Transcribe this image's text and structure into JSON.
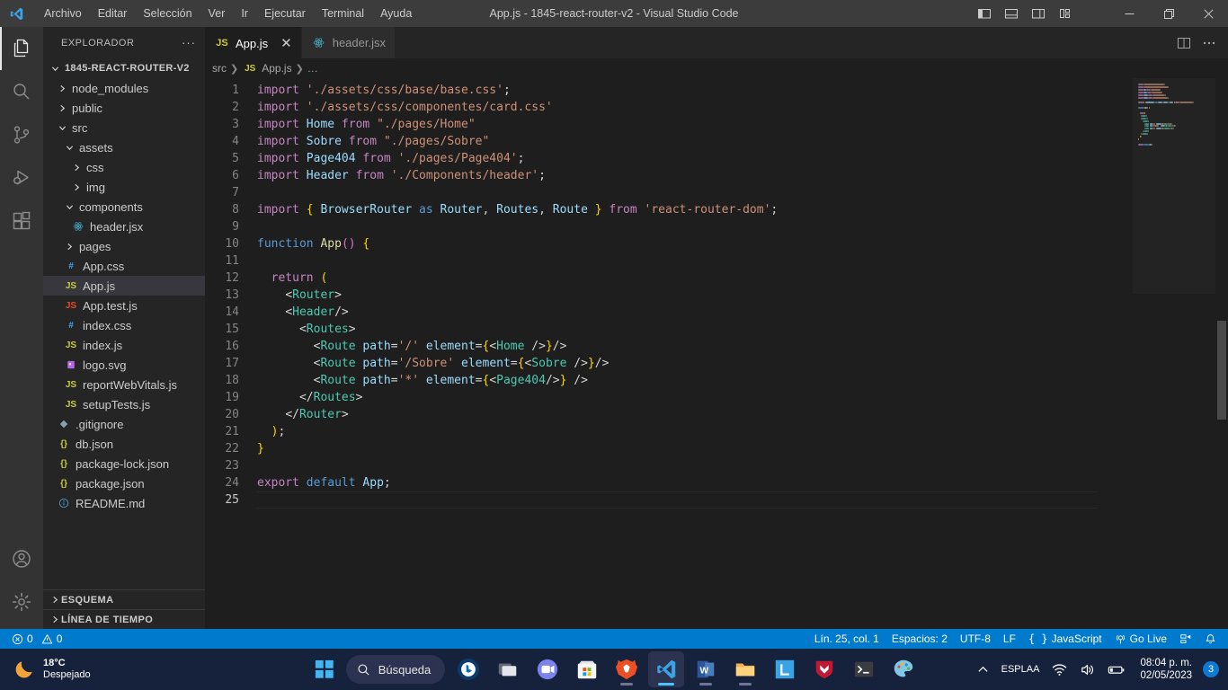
{
  "window": {
    "title": "App.js - 1845-react-router-v2 - Visual Studio Code",
    "menu": [
      "Archivo",
      "Editar",
      "Selección",
      "Ver",
      "Ir",
      "Ejecutar",
      "Terminal",
      "Ayuda"
    ],
    "layout_buttons": [
      "toggle-primary-sidebar",
      "toggle-panel",
      "toggle-secondary-sidebar",
      "customize-layout"
    ],
    "controls": {
      "minimize": "—",
      "maximize": "▢",
      "close": "✕"
    }
  },
  "activitybar": {
    "items": [
      {
        "name": "explorer",
        "icon": "files-icon",
        "active": true
      },
      {
        "name": "search",
        "icon": "search-icon",
        "active": false
      },
      {
        "name": "source-control",
        "icon": "source-control-icon",
        "active": false
      },
      {
        "name": "run-and-debug",
        "icon": "run-debug-icon",
        "active": false
      },
      {
        "name": "extensions",
        "icon": "extensions-icon",
        "active": false
      }
    ],
    "bottom": [
      {
        "name": "accounts",
        "icon": "account-icon"
      },
      {
        "name": "manage",
        "icon": "gear-icon"
      }
    ]
  },
  "sidebar": {
    "title": "EXPLORADOR",
    "more_actions": "···",
    "root": {
      "label": "1845-REACT-ROUTER-V2",
      "expanded": true
    },
    "tree": [
      {
        "label": "node_modules",
        "type": "folder",
        "depth": 1,
        "expanded": false,
        "icon": "chevron-right-icon"
      },
      {
        "label": "public",
        "type": "folder",
        "depth": 1,
        "expanded": false,
        "icon": "chevron-right-icon"
      },
      {
        "label": "src",
        "type": "folder",
        "depth": 1,
        "expanded": true,
        "icon": "chevron-down-icon"
      },
      {
        "label": "assets",
        "type": "folder",
        "depth": 2,
        "expanded": true,
        "icon": "chevron-down-icon"
      },
      {
        "label": "css",
        "type": "folder",
        "depth": 3,
        "expanded": false,
        "icon": "chevron-right-icon"
      },
      {
        "label": "img",
        "type": "folder",
        "depth": 3,
        "expanded": false,
        "icon": "chevron-right-icon"
      },
      {
        "label": "components",
        "type": "folder",
        "depth": 2,
        "expanded": true,
        "icon": "chevron-down-icon"
      },
      {
        "label": "header.jsx",
        "type": "file",
        "depth": 3,
        "icon": "react-icon",
        "color": "#4db6d6"
      },
      {
        "label": "pages",
        "type": "folder",
        "depth": 2,
        "expanded": false,
        "icon": "chevron-right-icon"
      },
      {
        "label": "App.css",
        "type": "file",
        "depth": 2,
        "icon": "css-icon",
        "color": "#42a5f5",
        "glyph": "#"
      },
      {
        "label": "App.js",
        "type": "file",
        "depth": 2,
        "icon": "js-icon",
        "color": "#cbcb41",
        "glyph": "JS",
        "selected": true
      },
      {
        "label": "App.test.js",
        "type": "file",
        "depth": 2,
        "icon": "js-test-icon",
        "color": "#e44d26",
        "glyph": "JS"
      },
      {
        "label": "index.css",
        "type": "file",
        "depth": 2,
        "icon": "css-icon",
        "color": "#42a5f5",
        "glyph": "#"
      },
      {
        "label": "index.js",
        "type": "file",
        "depth": 2,
        "icon": "js-icon",
        "color": "#cbcb41",
        "glyph": "JS"
      },
      {
        "label": "logo.svg",
        "type": "file",
        "depth": 2,
        "icon": "svg-icon",
        "color": "#b36ae2"
      },
      {
        "label": "reportWebVitals.js",
        "type": "file",
        "depth": 2,
        "icon": "js-icon",
        "color": "#cbcb41",
        "glyph": "JS"
      },
      {
        "label": "setupTests.js",
        "type": "file",
        "depth": 2,
        "icon": "js-icon",
        "color": "#cbcb41",
        "glyph": "JS"
      },
      {
        "label": ".gitignore",
        "type": "file",
        "depth": 1,
        "icon": "git-icon",
        "color": "#8ba3ae"
      },
      {
        "label": "db.json",
        "type": "file",
        "depth": 1,
        "icon": "json-icon",
        "color": "#cbcb41",
        "glyph": "{}"
      },
      {
        "label": "package-lock.json",
        "type": "file",
        "depth": 1,
        "icon": "json-icon",
        "color": "#cbcb41",
        "glyph": "{}"
      },
      {
        "label": "package.json",
        "type": "file",
        "depth": 1,
        "icon": "json-icon",
        "color": "#cbcb41",
        "glyph": "{}"
      },
      {
        "label": "README.md",
        "type": "file",
        "depth": 1,
        "icon": "info-icon",
        "color": "#4a9fd5"
      }
    ],
    "panels": [
      {
        "label": "ESQUEMA",
        "expanded": false
      },
      {
        "label": "LÍNEA DE TIEMPO",
        "expanded": false
      }
    ]
  },
  "editor": {
    "tabs": [
      {
        "label": "App.js",
        "icon": "js-icon",
        "glyph": "JS",
        "active": true,
        "close": "✕"
      },
      {
        "label": "header.jsx",
        "icon": "react-icon",
        "active": false
      }
    ],
    "actions": [
      "split-editor-right",
      "more-actions"
    ],
    "breadcrumbs": [
      {
        "label": "src",
        "icon": ""
      },
      {
        "label": "App.js",
        "icon": "js-icon",
        "glyph": "JS"
      },
      {
        "label": "…",
        "icon": ""
      }
    ],
    "total_lines": 25,
    "lines": [
      {
        "n": 1,
        "tokens": [
          {
            "t": "import ",
            "c": "t-kw"
          },
          {
            "t": "'./assets/css/base/base.css'",
            "c": "t-str"
          },
          {
            "t": ";",
            "c": "t-plain"
          }
        ]
      },
      {
        "n": 2,
        "tokens": [
          {
            "t": "import ",
            "c": "t-kw"
          },
          {
            "t": "'./assets/css/componentes/card.css'",
            "c": "t-str"
          }
        ]
      },
      {
        "n": 3,
        "tokens": [
          {
            "t": "import ",
            "c": "t-kw"
          },
          {
            "t": "Home",
            "c": "t-id"
          },
          {
            "t": " from ",
            "c": "t-kw"
          },
          {
            "t": "\"./pages/Home\"",
            "c": "t-str"
          }
        ]
      },
      {
        "n": 4,
        "tokens": [
          {
            "t": "import ",
            "c": "t-kw"
          },
          {
            "t": "Sobre",
            "c": "t-id"
          },
          {
            "t": " from ",
            "c": "t-kw"
          },
          {
            "t": "\"./pages/Sobre\"",
            "c": "t-str"
          }
        ]
      },
      {
        "n": 5,
        "tokens": [
          {
            "t": "import ",
            "c": "t-kw"
          },
          {
            "t": "Page404",
            "c": "t-id"
          },
          {
            "t": " from ",
            "c": "t-kw"
          },
          {
            "t": "'./pages/Page404'",
            "c": "t-str"
          },
          {
            "t": ";",
            "c": "t-plain"
          }
        ]
      },
      {
        "n": 6,
        "tokens": [
          {
            "t": "import ",
            "c": "t-kw"
          },
          {
            "t": "Header",
            "c": "t-id"
          },
          {
            "t": " from ",
            "c": "t-kw"
          },
          {
            "t": "'./Components/header'",
            "c": "t-str"
          },
          {
            "t": ";",
            "c": "t-plain"
          }
        ]
      },
      {
        "n": 7,
        "tokens": []
      },
      {
        "n": 8,
        "tokens": [
          {
            "t": "import ",
            "c": "t-kw"
          },
          {
            "t": "{",
            "c": "t-brace"
          },
          {
            "t": " ",
            "c": "t-plain"
          },
          {
            "t": "BrowserRouter",
            "c": "t-id"
          },
          {
            "t": " as ",
            "c": "t-kw2"
          },
          {
            "t": "Router",
            "c": "t-id"
          },
          {
            "t": ", ",
            "c": "t-plain"
          },
          {
            "t": "Routes",
            "c": "t-id"
          },
          {
            "t": ", ",
            "c": "t-plain"
          },
          {
            "t": "Route",
            "c": "t-id"
          },
          {
            "t": " ",
            "c": "t-plain"
          },
          {
            "t": "}",
            "c": "t-brace"
          },
          {
            "t": " from ",
            "c": "t-kw"
          },
          {
            "t": "'react-router-dom'",
            "c": "t-str"
          },
          {
            "t": ";",
            "c": "t-plain"
          }
        ]
      },
      {
        "n": 9,
        "tokens": []
      },
      {
        "n": 10,
        "tokens": [
          {
            "t": "function ",
            "c": "t-kw2"
          },
          {
            "t": "App",
            "c": "t-fn"
          },
          {
            "t": "()",
            "c": "t-brace2"
          },
          {
            "t": " ",
            "c": "t-plain"
          },
          {
            "t": "{",
            "c": "t-brace"
          }
        ]
      },
      {
        "n": 11,
        "tokens": []
      },
      {
        "n": 12,
        "tokens": [
          {
            "t": "  ",
            "c": "t-plain"
          },
          {
            "t": "return ",
            "c": "t-kw"
          },
          {
            "t": "(",
            "c": "t-brace"
          }
        ]
      },
      {
        "n": 13,
        "tokens": [
          {
            "t": "    ",
            "c": "t-plain"
          },
          {
            "t": "<",
            "c": "t-punct"
          },
          {
            "t": "Router",
            "c": "t-tag"
          },
          {
            "t": ">",
            "c": "t-punct"
          }
        ]
      },
      {
        "n": 14,
        "tokens": [
          {
            "t": "    ",
            "c": "t-plain"
          },
          {
            "t": "<",
            "c": "t-punct"
          },
          {
            "t": "Header",
            "c": "t-tag"
          },
          {
            "t": "/>",
            "c": "t-punct"
          }
        ]
      },
      {
        "n": 15,
        "tokens": [
          {
            "t": "      ",
            "c": "t-plain"
          },
          {
            "t": "<",
            "c": "t-punct"
          },
          {
            "t": "Routes",
            "c": "t-tag"
          },
          {
            "t": ">",
            "c": "t-punct"
          }
        ]
      },
      {
        "n": 16,
        "tokens": [
          {
            "t": "        ",
            "c": "t-plain"
          },
          {
            "t": "<",
            "c": "t-punct"
          },
          {
            "t": "Route",
            "c": "t-tag"
          },
          {
            "t": " ",
            "c": "t-plain"
          },
          {
            "t": "path",
            "c": "t-attr"
          },
          {
            "t": "=",
            "c": "t-punct"
          },
          {
            "t": "'/'",
            "c": "t-str"
          },
          {
            "t": " ",
            "c": "t-plain"
          },
          {
            "t": "element",
            "c": "t-attr"
          },
          {
            "t": "=",
            "c": "t-punct"
          },
          {
            "t": "{",
            "c": "t-brace"
          },
          {
            "t": "<",
            "c": "t-punct"
          },
          {
            "t": "Home",
            "c": "t-tag"
          },
          {
            "t": " />",
            "c": "t-punct"
          },
          {
            "t": "}",
            "c": "t-brace"
          },
          {
            "t": "/>",
            "c": "t-punct"
          }
        ]
      },
      {
        "n": 17,
        "tokens": [
          {
            "t": "        ",
            "c": "t-plain"
          },
          {
            "t": "<",
            "c": "t-punct"
          },
          {
            "t": "Route",
            "c": "t-tag"
          },
          {
            "t": " ",
            "c": "t-plain"
          },
          {
            "t": "path",
            "c": "t-attr"
          },
          {
            "t": "=",
            "c": "t-punct"
          },
          {
            "t": "'/Sobre'",
            "c": "t-str"
          },
          {
            "t": " ",
            "c": "t-plain"
          },
          {
            "t": "element",
            "c": "t-attr"
          },
          {
            "t": "=",
            "c": "t-punct"
          },
          {
            "t": "{",
            "c": "t-brace"
          },
          {
            "t": "<",
            "c": "t-punct"
          },
          {
            "t": "Sobre",
            "c": "t-tag"
          },
          {
            "t": " />",
            "c": "t-punct"
          },
          {
            "t": "}",
            "c": "t-brace"
          },
          {
            "t": "/>",
            "c": "t-punct"
          }
        ]
      },
      {
        "n": 18,
        "tokens": [
          {
            "t": "        ",
            "c": "t-plain"
          },
          {
            "t": "<",
            "c": "t-punct"
          },
          {
            "t": "Route",
            "c": "t-tag"
          },
          {
            "t": " ",
            "c": "t-plain"
          },
          {
            "t": "path",
            "c": "t-attr"
          },
          {
            "t": "=",
            "c": "t-punct"
          },
          {
            "t": "'*'",
            "c": "t-str"
          },
          {
            "t": " ",
            "c": "t-plain"
          },
          {
            "t": "element",
            "c": "t-attr"
          },
          {
            "t": "=",
            "c": "t-punct"
          },
          {
            "t": "{",
            "c": "t-brace"
          },
          {
            "t": "<",
            "c": "t-punct"
          },
          {
            "t": "Page404",
            "c": "t-tag"
          },
          {
            "t": "/>",
            "c": "t-punct"
          },
          {
            "t": "}",
            "c": "t-brace"
          },
          {
            "t": " />",
            "c": "t-punct"
          }
        ]
      },
      {
        "n": 19,
        "tokens": [
          {
            "t": "      ",
            "c": "t-plain"
          },
          {
            "t": "</",
            "c": "t-punct"
          },
          {
            "t": "Routes",
            "c": "t-tag"
          },
          {
            "t": ">",
            "c": "t-punct"
          }
        ]
      },
      {
        "n": 20,
        "tokens": [
          {
            "t": "    ",
            "c": "t-plain"
          },
          {
            "t": "</",
            "c": "t-punct"
          },
          {
            "t": "Router",
            "c": "t-tag"
          },
          {
            "t": ">",
            "c": "t-punct"
          }
        ]
      },
      {
        "n": 21,
        "tokens": [
          {
            "t": "  ",
            "c": "t-plain"
          },
          {
            "t": ")",
            "c": "t-brace"
          },
          {
            "t": ";",
            "c": "t-plain"
          }
        ]
      },
      {
        "n": 22,
        "tokens": [
          {
            "t": "}",
            "c": "t-brace"
          }
        ]
      },
      {
        "n": 23,
        "tokens": []
      },
      {
        "n": 24,
        "tokens": [
          {
            "t": "export ",
            "c": "t-kw"
          },
          {
            "t": "default ",
            "c": "t-kw2"
          },
          {
            "t": "App",
            "c": "t-id"
          },
          {
            "t": ";",
            "c": "t-plain"
          }
        ]
      },
      {
        "n": 25,
        "tokens": []
      }
    ],
    "cursor_line": 25
  },
  "statusbar": {
    "errors": "0",
    "warnings": "0",
    "position": "Lín. 25, col. 1",
    "indentation": "Espacios: 2",
    "encoding": "UTF-8",
    "eol": "LF",
    "language": "JavaScript",
    "golive": "Go Live",
    "icons": [
      "error-icon",
      "warning-icon",
      "remote-icon",
      "bell-icon"
    ],
    "accent": "#007acc"
  },
  "taskbar": {
    "weather": {
      "temp": "18°C",
      "condition": "Despejado",
      "icon": "moon-icon"
    },
    "start": "start-icon",
    "search": {
      "placeholder": "Búsqueda",
      "icon": "search-icon"
    },
    "apps": [
      {
        "name": "bing-chat",
        "icon": "bing-icon",
        "running": false
      },
      {
        "name": "task-view",
        "icon": "task-view-icon",
        "running": false
      },
      {
        "name": "microsoft-teams",
        "icon": "teams-icon",
        "running": false
      },
      {
        "name": "microsoft-store",
        "icon": "store-icon",
        "running": false
      },
      {
        "name": "brave-browser",
        "icon": "brave-icon",
        "running": true
      },
      {
        "name": "visual-studio-code",
        "icon": "vscode-icon",
        "running": true,
        "active": true
      },
      {
        "name": "microsoft-word",
        "icon": "word-icon",
        "running": true
      },
      {
        "name": "file-explorer",
        "icon": "folder-icon",
        "running": true
      },
      {
        "name": "lightshot",
        "icon": "lightshot-icon",
        "running": false
      },
      {
        "name": "mcafee",
        "icon": "mcafee-icon",
        "running": false
      },
      {
        "name": "terminal",
        "icon": "terminal-icon",
        "running": false
      },
      {
        "name": "paint",
        "icon": "paint-icon",
        "running": false
      }
    ],
    "tray": {
      "overflow": "show-hidden-icons",
      "language": {
        "line1": "ESP",
        "line2": "LAA"
      },
      "icons": [
        "wifi-icon",
        "volume-icon",
        "battery-icon"
      ],
      "time": "08:04 p. m.",
      "date": "02/05/2023",
      "notification_count": "3"
    }
  }
}
